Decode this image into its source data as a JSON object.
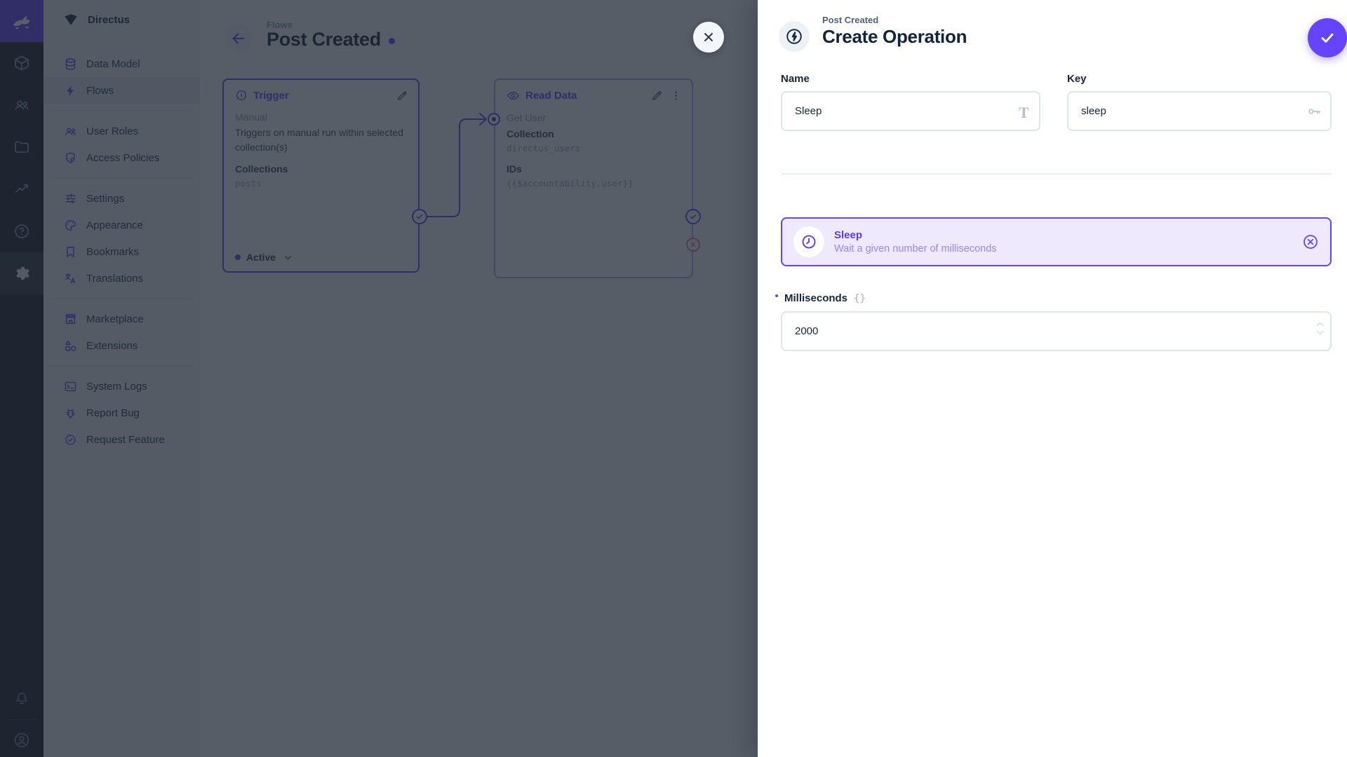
{
  "colors": {
    "accent": "#6644ff",
    "danger": "#e35169",
    "module_bar_bg": "#21262e",
    "sidebar_bg": "#eef2f7"
  },
  "sidebar": {
    "project_name": "Directus",
    "items": [
      {
        "label": "Data Model"
      },
      {
        "label": "Flows"
      },
      {
        "label": "User Roles"
      },
      {
        "label": "Access Policies"
      },
      {
        "label": "Settings"
      },
      {
        "label": "Appearance"
      },
      {
        "label": "Bookmarks"
      },
      {
        "label": "Translations"
      },
      {
        "label": "Marketplace"
      },
      {
        "label": "Extensions"
      },
      {
        "label": "System Logs"
      },
      {
        "label": "Report Bug"
      },
      {
        "label": "Request Feature"
      }
    ]
  },
  "flow": {
    "breadcrumb": "Flows",
    "title": "Post Created",
    "trigger_panel": {
      "title": "Trigger",
      "type": "Manual",
      "description": "Triggers on manual run within selected collection(s)",
      "collections_label": "Collections",
      "collections_value": "posts",
      "status": "Active"
    },
    "read_data_panel": {
      "title": "Read Data",
      "name": "Get User",
      "collection_label": "Collection",
      "collection_value": "directus_users",
      "ids_label": "IDs",
      "ids_value": "{{$accountability.user}}"
    }
  },
  "drawer": {
    "breadcrumb": "Post Created",
    "title": "Create Operation",
    "name_field": {
      "label": "Name",
      "value": "Sleep"
    },
    "key_field": {
      "label": "Key",
      "value": "sleep"
    },
    "operation_card": {
      "title": "Sleep",
      "description": "Wait a given number of milliseconds"
    },
    "milliseconds_field": {
      "label": "Milliseconds",
      "value": "2000",
      "raw_toggle": "{}"
    }
  }
}
